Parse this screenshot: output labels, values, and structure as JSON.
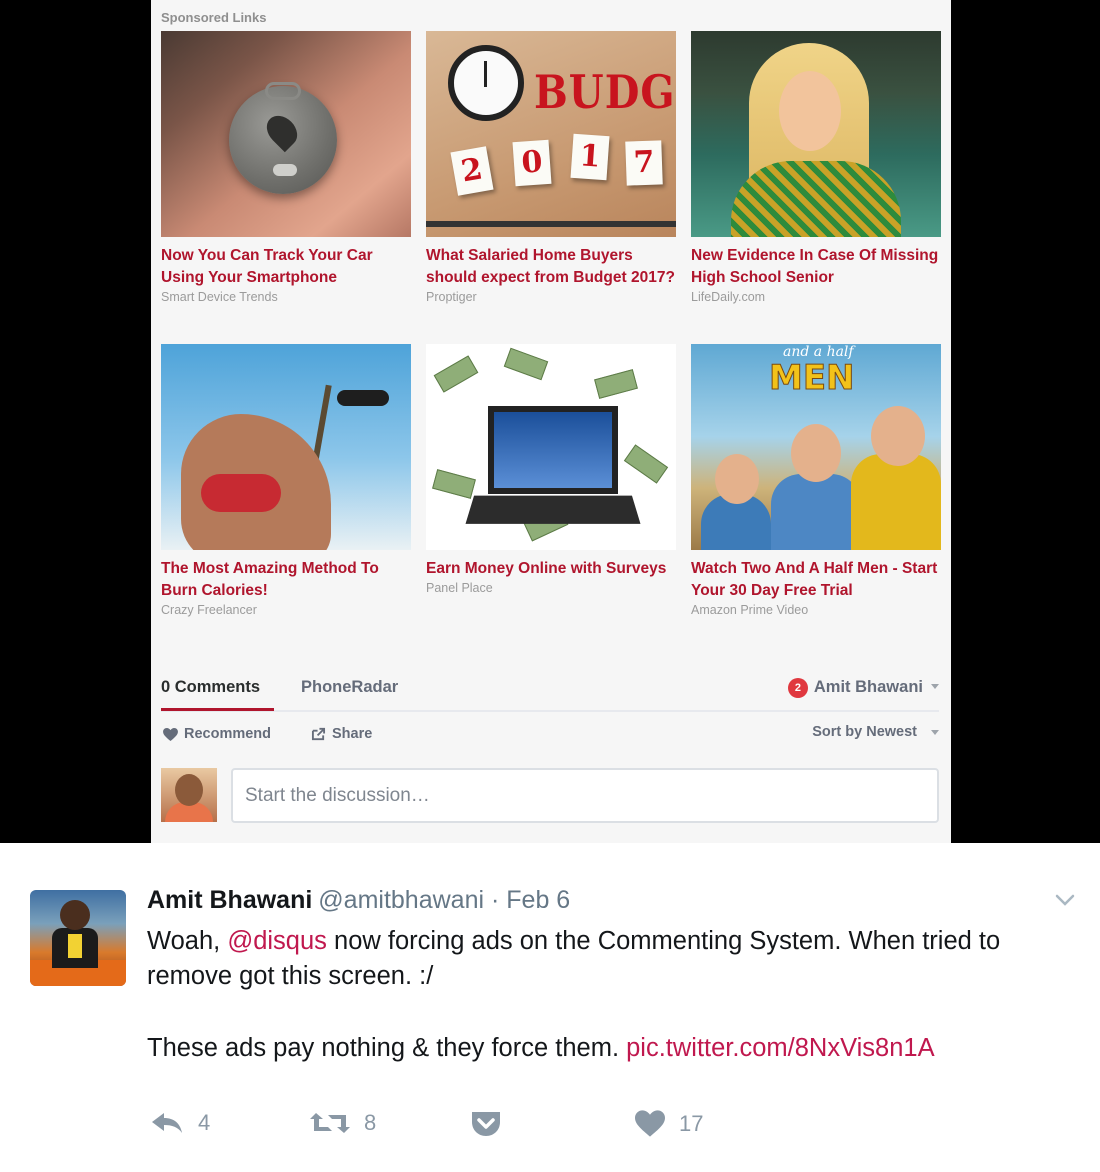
{
  "disqus": {
    "sponsored_label": "Sponsored Links",
    "ads": [
      {
        "title": "Now You Can Track Your Car Using Your Smartphone",
        "source": "Smart Device Trends"
      },
      {
        "title": "What Salaried Home Buyers should expect from Budget 2017?",
        "source": "Proptiger",
        "image_text": "BUDGET",
        "image_digits": [
          "2",
          "0",
          "1",
          "7"
        ]
      },
      {
        "title": "New Evidence In Case Of Missing High School Senior",
        "source": "LifeDaily.com"
      },
      {
        "title": "The Most Amazing Method To Burn Calories!",
        "source": "Crazy Freelancer"
      },
      {
        "title": "Earn Money Online with Surveys",
        "source": "Panel Place"
      },
      {
        "title": "Watch Two And A Half Men - Start Your 30 Day Free Trial",
        "source": "Amazon Prime Video",
        "image_text_small": "and a half",
        "image_text_big": "MEN"
      }
    ],
    "tabs": {
      "comments": "0 Comments",
      "site": "PhoneRadar"
    },
    "user": {
      "name": "Amit Bhawani",
      "notifications": "2"
    },
    "actions": {
      "recommend": "Recommend",
      "share": "Share",
      "sort": "Sort by Newest"
    },
    "composer_placeholder": "Start the discussion…",
    "colors": {
      "accent": "#b0152d",
      "badge": "#e0383f"
    }
  },
  "tweet": {
    "name": "Amit Bhawani",
    "handle": "@amitbhawani",
    "separator": "·",
    "date": "Feb 6",
    "line1_pre": "Woah, ",
    "mention": "@disqus",
    "line1_post": " now forcing ads on the Commenting System. When tried to remove got this screen. :/",
    "line2_pre": "These ads pay nothing & they force them. ",
    "link": "pic.twitter.com/8NxVis8n1A",
    "actions": {
      "replies": "4",
      "retweets": "8",
      "likes": "17"
    },
    "icons": [
      "reply-icon",
      "retweet-icon",
      "pocket-icon",
      "heart-icon",
      "chevron-down-icon"
    ],
    "colors": {
      "link": "#c0184e",
      "muted": "#8a98a5"
    }
  }
}
